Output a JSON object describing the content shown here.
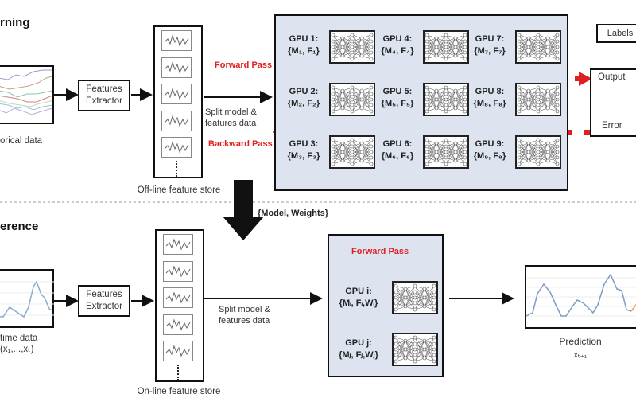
{
  "training": {
    "section_title": "rning",
    "historical_label": "orical data",
    "extractor_label_line1": "Features",
    "extractor_label_line2": "Extractor",
    "store_label": "Off-line feature store",
    "split_label_line1": "Split model &",
    "split_label_line2": "features data",
    "forward_pass": "Forward Pass",
    "backward_pass": "Backward Pass",
    "gpus": [
      {
        "name": "GPU 1:",
        "set": "{M₁, F₁}"
      },
      {
        "name": "GPU 2:",
        "set": "{M₂, F₂}"
      },
      {
        "name": "GPU 3:",
        "set": "{M₃, F₃}"
      },
      {
        "name": "GPU 4:",
        "set": "{M₄, F₄}"
      },
      {
        "name": "GPU 5:",
        "set": "{M₅, F₅}"
      },
      {
        "name": "GPU 6:",
        "set": "{M₆, F₆}"
      },
      {
        "name": "GPU 7:",
        "set": "{M₇, F₇}"
      },
      {
        "name": "GPU 8:",
        "set": "{M₈, F₈}"
      },
      {
        "name": "GPU 9:",
        "set": "{M₉, F₉}"
      }
    ],
    "labels_box": "Labels",
    "output_label": "Output",
    "error_label": "Error"
  },
  "transfer_label": "{Model, Weights}",
  "inference": {
    "section_title": "erence",
    "realtime_label_line1": "time data",
    "realtime_label_line2": "(x₁,...,xₜ)",
    "extractor_label_line1": "Features",
    "extractor_label_line2": "Extractor",
    "store_label": "On-line feature store",
    "split_label_line1": "Split model &",
    "split_label_line2": "features data",
    "forward_pass": "Forward Pass",
    "gpus": [
      {
        "name": "GPU i:",
        "set": "{Mᵢ, Fᵢ,Wᵢ}"
      },
      {
        "name": "GPU j:",
        "set": "{Mⱼ, Fⱼ,Wⱼ}"
      }
    ],
    "prediction_label": "Prediction",
    "prediction_var": "xₜ₊₁"
  },
  "colors": {
    "accent_red": "#e02020",
    "gpu_panel_bg": "#dde4f0",
    "series_blue": "#7a9cc6",
    "prediction_orange": "#e8a040"
  }
}
